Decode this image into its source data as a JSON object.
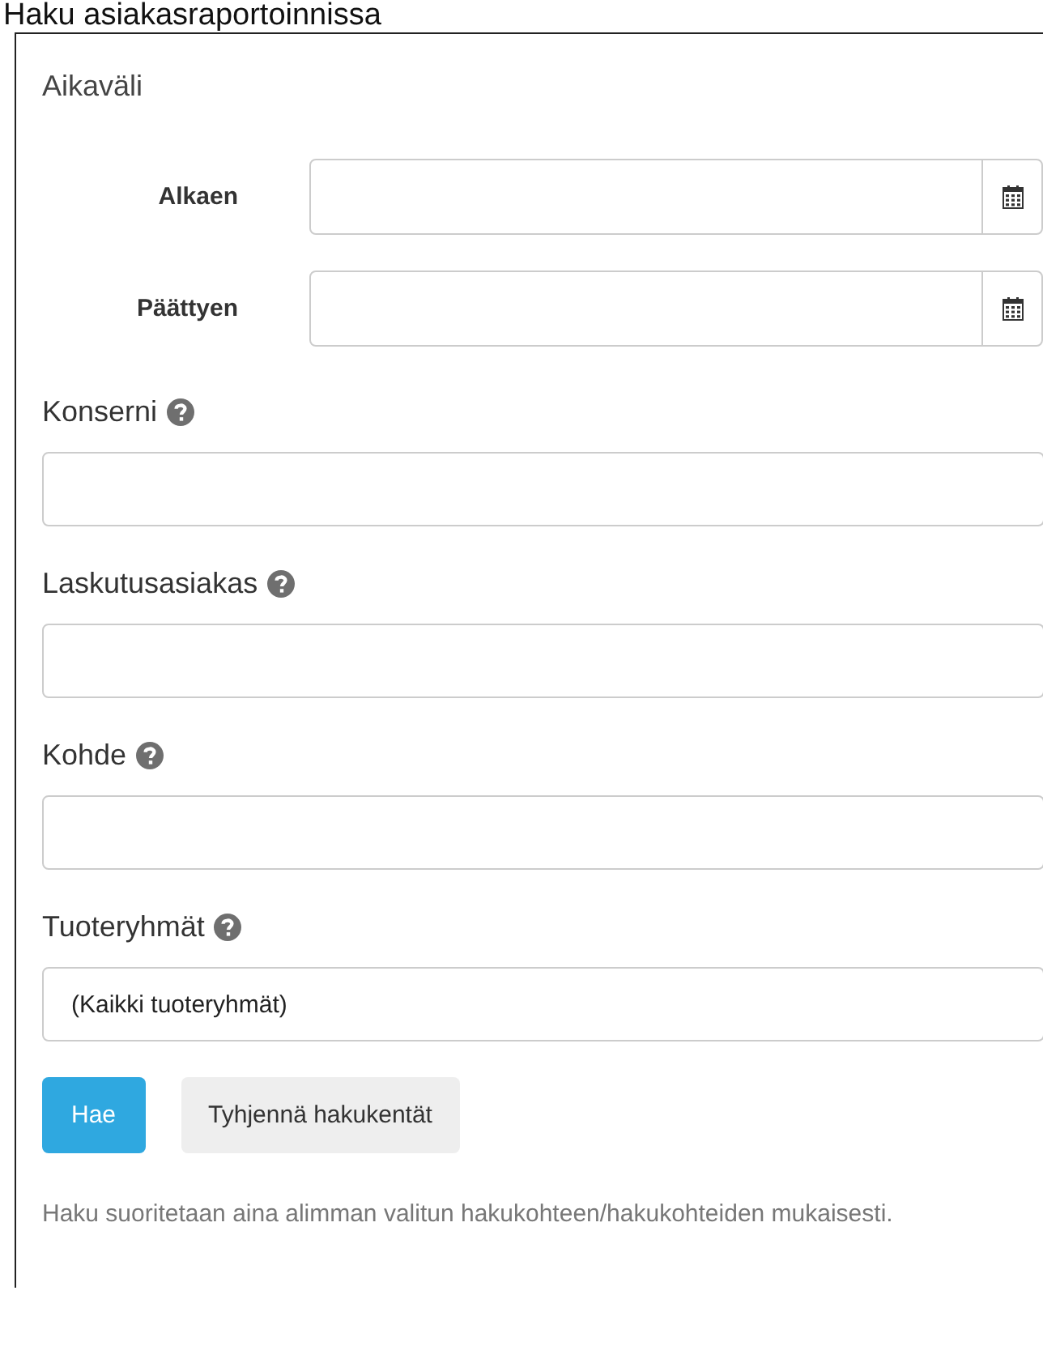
{
  "title": "Haku asiakasraportoinnissa",
  "date_range": {
    "heading": "Aikaväli",
    "fields": [
      {
        "label": "Alkaen"
      },
      {
        "label": "Päättyen"
      }
    ]
  },
  "fields": [
    {
      "label": "Konserni",
      "help": true
    },
    {
      "label": "Laskutusasiakas",
      "help": true
    },
    {
      "label": "Kohde",
      "help": true
    },
    {
      "label": "Tuoteryhmät",
      "help": true,
      "value": "(Kaikki tuoteryhmät)"
    }
  ],
  "buttons": [
    {
      "label": "Hae",
      "kind": "primary"
    },
    {
      "label": "Tyhjennä hakukentät",
      "kind": "default"
    }
  ],
  "note": "Haku suoritetaan aina alimman valitun hakukohteen/hakukohteiden mukaisesti."
}
